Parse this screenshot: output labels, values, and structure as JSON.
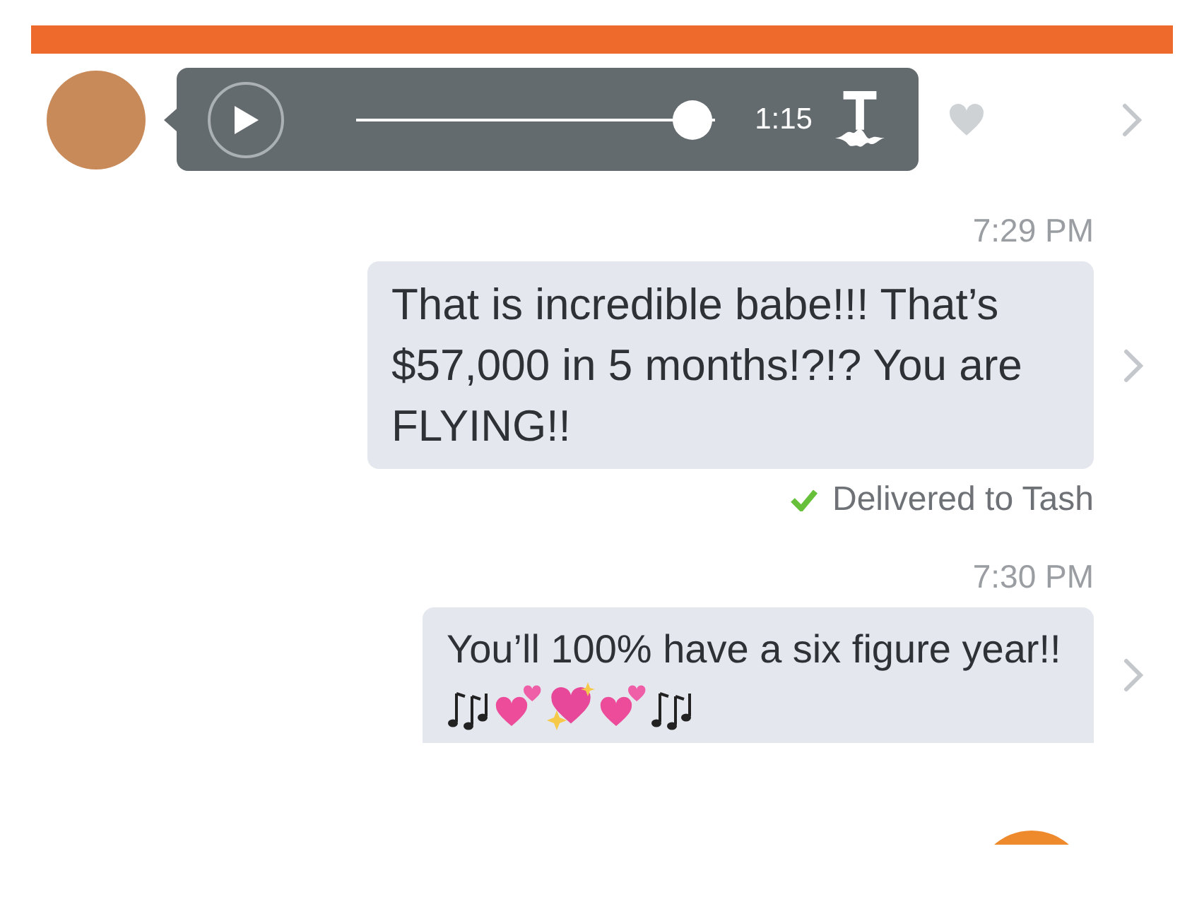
{
  "voice_message": {
    "level": 0.95,
    "duration": "1:15",
    "liked": false
  },
  "messages": [
    {
      "time": "7:29 PM",
      "text": "That is incredible babe!!! That’s $57,000 in 5 months!?!? You are FLYING!!",
      "status": "Delivered to Tash",
      "delivered": true,
      "emoji": false
    },
    {
      "time": "7:30 PM",
      "text": "You’ll 100% have a six figure year!!",
      "emoji": true
    }
  ]
}
